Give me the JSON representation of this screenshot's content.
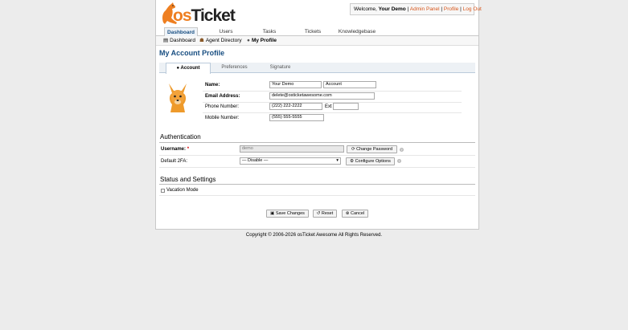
{
  "header": {
    "logo_prefix": "os",
    "logo_suffix": "Ticket",
    "welcome_prefix": "Welcome, ",
    "user_name": "Your Demo",
    "admin_panel": "Admin Panel",
    "profile": "Profile",
    "logout": "Log Out",
    "separator": " | "
  },
  "nav": {
    "tabs": [
      {
        "label": "Dashboard",
        "active": true
      },
      {
        "label": "Users"
      },
      {
        "label": "Tasks"
      },
      {
        "label": "Tickets"
      },
      {
        "label": "Knowledgebase"
      }
    ]
  },
  "subnav": {
    "items": [
      {
        "label": "Dashboard",
        "icon": "dashboard-icon"
      },
      {
        "label": "Agent Directory",
        "icon": "directory-icon"
      },
      {
        "label": "My Profile",
        "icon": "user-icon",
        "active": true
      }
    ]
  },
  "page": {
    "title": "My Account Profile"
  },
  "tabs": [
    {
      "label": "Account",
      "icon": "user-icon",
      "active": true
    },
    {
      "label": "Preferences"
    },
    {
      "label": "Signature"
    }
  ],
  "account": {
    "name_label": "Name:",
    "first_name": "Your Demo",
    "last_name": "Account",
    "email_label": "Email Address:",
    "email": "delete@osticketawesome.com",
    "phone_label": "Phone Number:",
    "phone": "(222) 222-2222",
    "ext_label": "Ext",
    "ext": "",
    "mobile_label": "Mobile Number:",
    "mobile": "(555) 555-5555"
  },
  "authentication": {
    "title": "Authentication",
    "username_label": "Username:",
    "username_required": "*",
    "username": "demo",
    "change_password": "Change Password",
    "twofa_label": "Default 2FA:",
    "twofa_value": "— Disable —",
    "configure_options": "Configure Options",
    "help": "?"
  },
  "status": {
    "title": "Status and Settings",
    "vacation_label": "Vacation Mode"
  },
  "actions": {
    "save": "Save Changes",
    "reset": "Reset",
    "cancel": "Cancel"
  },
  "footer": {
    "copyright": "Copyright © 2006-2026 osTicket Awesome All Rights Reserved."
  },
  "colors": {
    "accent": "#184e81",
    "link": "#d7561b",
    "logo_orange": "#ee7f21"
  }
}
